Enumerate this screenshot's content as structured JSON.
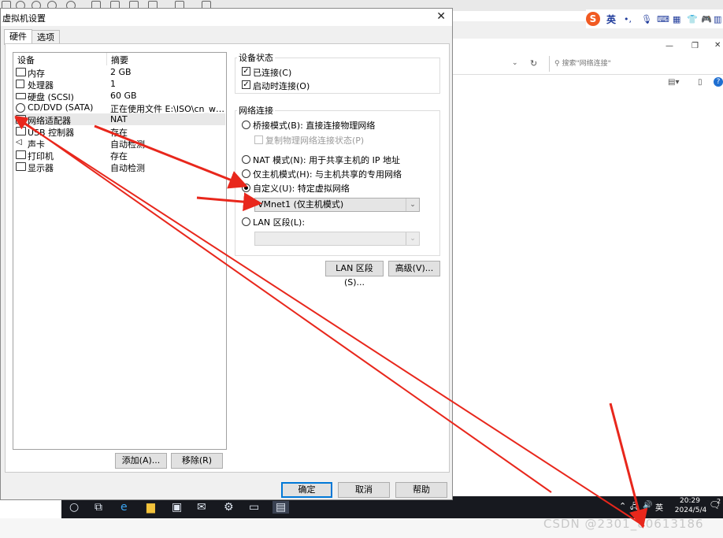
{
  "dialog": {
    "title": "虚拟机设置",
    "close_label": "✕",
    "tabs": [
      {
        "label": "硬件",
        "active": true
      },
      {
        "label": "选项",
        "active": false
      }
    ]
  },
  "device_list": {
    "headers": {
      "device": "设备",
      "summary": "摘要"
    },
    "items": [
      {
        "name": "内存",
        "summary": "2 GB",
        "icon": "memory-icon"
      },
      {
        "name": "处理器",
        "summary": "1",
        "icon": "cpu-icon"
      },
      {
        "name": "硬盘 (SCSI)",
        "summary": "60 GB",
        "icon": "harddisk-icon"
      },
      {
        "name": "CD/DVD (SATA)",
        "summary": "正在使用文件 E:\\ISO\\cn_win...",
        "icon": "cdrom-icon"
      },
      {
        "name": "网络适配器",
        "summary": "NAT",
        "icon": "network-icon",
        "selected": true
      },
      {
        "name": "USB 控制器",
        "summary": "存在",
        "icon": "usb-icon"
      },
      {
        "name": "声卡",
        "summary": "自动检测",
        "icon": "sound-icon"
      },
      {
        "name": "打印机",
        "summary": "存在",
        "icon": "printer-icon"
      },
      {
        "name": "显示器",
        "summary": "自动检测",
        "icon": "monitor-icon"
      }
    ],
    "add_button": "添加(A)...",
    "remove_button": "移除(R)"
  },
  "device_status": {
    "title": "设备状态",
    "connected": {
      "label": "已连接(C)",
      "checked": true
    },
    "connect_on_power": {
      "label": "启动时连接(O)",
      "checked": true
    }
  },
  "network_connection": {
    "title": "网络连接",
    "bridged": {
      "label": "桥接模式(B): 直接连接物理网络",
      "selected": false
    },
    "replicate": {
      "label": "复制物理网络连接状态(P)",
      "checked": false
    },
    "nat": {
      "label": "NAT 模式(N): 用于共享主机的 IP 地址",
      "selected": false
    },
    "hostonly": {
      "label": "仅主机模式(H): 与主机共享的专用网络",
      "selected": false
    },
    "custom": {
      "label": "自定义(U): 特定虚拟网络",
      "selected": true
    },
    "custom_value": "VMnet1 (仅主机模式)",
    "lan": {
      "label": "LAN 区段(L):",
      "selected": false
    },
    "lan_value": "",
    "lan_button": "LAN 区段(S)...",
    "advanced_button": "高级(V)..."
  },
  "footer": {
    "ok": "确定",
    "cancel": "取消",
    "help": "帮助"
  },
  "background": {
    "search_placeholder": "搜索\"网络连接\"",
    "ime_lang": "英",
    "tray_lang": "英",
    "time": "20:29",
    "date": "2024/5/4",
    "tray_count": "2",
    "watermark": "CSDN @2301_80613186"
  },
  "colors": {
    "arrow": "#e8271c",
    "accent": "#0078d7",
    "taskbar": "#17191f"
  }
}
